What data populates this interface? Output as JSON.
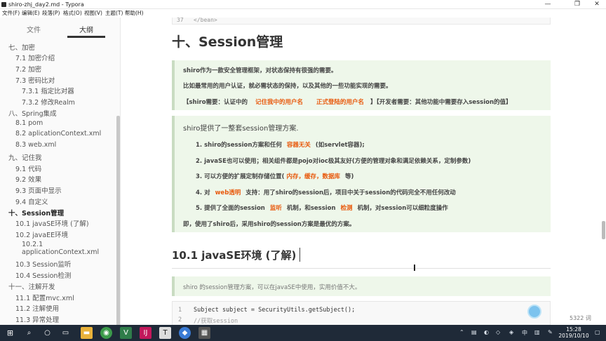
{
  "window": {
    "title": "shiro-zhj_day2.md - Typora"
  },
  "menu": [
    "文件(F)",
    "编辑(E)",
    "段落(P)",
    "格式(O)",
    "视图(V)",
    "主题(T)",
    "帮助(H)"
  ],
  "sidebar": {
    "tabs": [
      "文件",
      "大纲"
    ],
    "outline": [
      "七、加密",
      "7.1 加密介绍",
      "7.2 加密",
      "7.3 密码比对",
      "7.3.1 指定比对器",
      "7.3.2 修改Realm",
      "八、Spring集成",
      "8.1 pom",
      "8.2 aplicationContext.xml",
      "8.3 web.xml",
      "九、记住我",
      "9.1 代码",
      "9.2 效果",
      "9.3 页面中显示",
      "9.4 自定义",
      "十、Session管理",
      "10.1 javaSE环境 (了解)",
      "10.2 javaEE环境",
      "10.2.1",
      "applicationContext.xml",
      "10.3 Session监听",
      "10.4 Session检测",
      "十一、注解开发",
      "11.1 配置mvc.xml",
      "11.2 注解使用",
      "11.3 异常处理"
    ],
    "footer_back": "‹",
    "footer_code": "</>"
  },
  "editor": {
    "code_top_line_no": "37",
    "code_top_text": "</bean>",
    "h1": "十、Session管理",
    "quote1": {
      "line1": "shiro作为一款安全管理框架，对状态保持有很强的需要。",
      "line2": "比如最常用的用户认证，就必需状态的保持，以及其他的一些功能实现的需要。",
      "line3_a": "【shiro需要：认证中的",
      "line3_hl1": "记住我中的用户名",
      "line3_hl2": "正式登陆的用户名",
      "line3_b": "】【开发者需要：其他功能中需要存入session的值】"
    },
    "quote2": {
      "title": "shiro提供了一整套session管理方案.",
      "i1_a": "1. shiro的session方案和任何",
      "i1_hl": "容器无关",
      "i1_b": "(如servlet容器);",
      "i2": "2. javaSE也可以使用；相关组件都是pojo对ioc极其友好(方便的管理对象和满足依赖关系，定制参数)",
      "i3_a": "3. 可以方便的扩展定制存储位置(",
      "i3_hl": "内存，缓存，数据库",
      "i3_b": "等)",
      "i4_a": "4. 对",
      "i4_hl": "web透明",
      "i4_b": "支持：用了shiro的session后，项目中关于session的代码完全不用任何改动",
      "i5_a": "5. 提供了全面的session",
      "i5_hl1": "监听",
      "i5_b": "机制，和session",
      "i5_hl2": "检测",
      "i5_c": "机制，对session可以细粒度操作",
      "footer": "即，使用了shiro后，采用shiro的session方案是最优的方案。"
    },
    "h2": "10.1 javaSE环境 (了解)",
    "quote3": "shiro 的session管理方案，可以在javaSE中使用，实用价值不大。",
    "code": [
      {
        "n": "1",
        "t": "Subject subject = SecurityUtils.getSubject();"
      },
      {
        "n": "2",
        "t": "//获取session"
      }
    ],
    "wordcount": "5322 词"
  },
  "taskbar": {
    "time": "15:28",
    "date": "2019/10/10"
  }
}
